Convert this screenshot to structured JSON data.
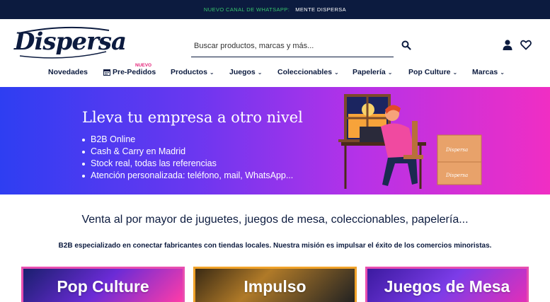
{
  "topbar": {
    "promo": "NUEVO CANAL DE WHATSAPP:",
    "promo_link": "MENTE DISPERSA"
  },
  "header": {
    "logo": "Dispersa",
    "search_placeholder": "Buscar productos, marcas y más..."
  },
  "nav": {
    "nuevo_badge": "NUEVO",
    "items": [
      {
        "label": "Novedades",
        "chevron": ""
      },
      {
        "label": "Pre-Pedidos",
        "chevron": ""
      },
      {
        "label": "Productos",
        "chevron": "⌄"
      },
      {
        "label": "Juegos",
        "chevron": "⌄"
      },
      {
        "label": "Coleccionables",
        "chevron": "⌄"
      },
      {
        "label": "Papelería",
        "chevron": "⌄"
      },
      {
        "label": "Pop Culture",
        "chevron": "⌄"
      },
      {
        "label": "Marcas",
        "chevron": "⌄"
      }
    ]
  },
  "banner": {
    "title": "Lleva tu empresa a otro nivel",
    "bullets": [
      "B2B Online",
      "Cash & Carry en Madrid",
      "Stock real, todas las referencias",
      "Atención personalizada: teléfono, mail, WhatsApp..."
    ],
    "box_label": "Dispersa"
  },
  "intro": {
    "title": "Venta al por mayor de juguetes, juegos de mesa, coleccionables, papelería...",
    "subtitle": "B2B especializado en conectar fabricantes con tiendas locales. Nuestra misión es impulsar el éxito de los comercios minoristas."
  },
  "categories": [
    {
      "label": "Pop Culture"
    },
    {
      "label": "Impulso"
    },
    {
      "label": "Juegos de Mesa"
    }
  ],
  "colors": {
    "navy": "#0c1b3f",
    "whatsapp_green": "#37c66e",
    "accent_pink": "#e4257a"
  }
}
